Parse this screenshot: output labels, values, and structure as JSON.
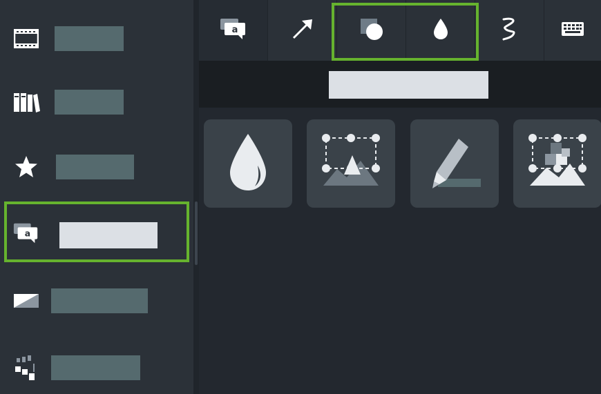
{
  "sidebar": {
    "items": [
      {
        "icon": "film-strip-icon",
        "label": ""
      },
      {
        "icon": "library-books-icon",
        "label": ""
      },
      {
        "icon": "star-icon",
        "label": ""
      },
      {
        "icon": "annotation-callout-icon",
        "label": "",
        "selected": true
      },
      {
        "icon": "transition-icon",
        "label": ""
      },
      {
        "icon": "animation-behaviors-icon",
        "label": ""
      }
    ]
  },
  "toolbar": {
    "tabs": [
      {
        "icon": "callout-icon",
        "active": true
      },
      {
        "icon": "arrow-icon"
      },
      {
        "icon": "shape-icon"
      },
      {
        "icon": "blur-drop-icon"
      },
      {
        "icon": "sketch-motion-icon"
      },
      {
        "icon": "keyboard-icon"
      }
    ],
    "highlight_color": "#66b32e"
  },
  "section": {
    "title": ""
  },
  "effects": [
    {
      "icon": "blur-drop-effect-icon"
    },
    {
      "icon": "spotlight-effect-icon"
    },
    {
      "icon": "highlight-pen-effect-icon"
    },
    {
      "icon": "pixelate-effect-icon"
    }
  ],
  "colors": {
    "accent": "#66b32e",
    "placeholder_text": "#556a6e",
    "selected_text": "#dce0e5"
  }
}
